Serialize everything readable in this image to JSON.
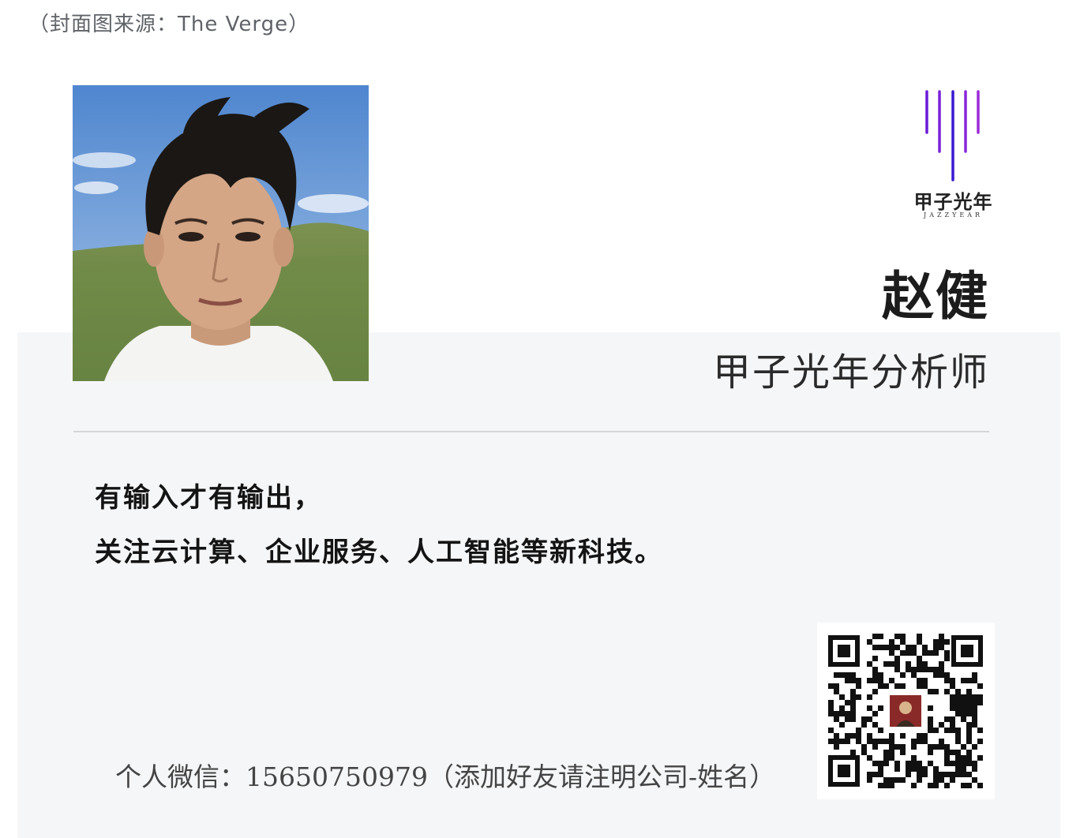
{
  "caption": "（封面图来源：The Verge）",
  "logo": {
    "name": "甲子光年",
    "sub": "JAZZYEAR",
    "accent_colors": [
      "#6a1bd6",
      "#9b2bd9",
      "#3a1ad0"
    ]
  },
  "profile": {
    "name": "赵健",
    "title": "甲子光年分析师",
    "photo_icon": "portrait-photo"
  },
  "motto": {
    "line1": "有输入才有输出，",
    "line2": "关注云计算、企业服务、人工智能等新科技。"
  },
  "contact": {
    "wechat": "个人微信：15650750979（添加好友请注明公司-姓名）",
    "qr_icon": "wechat-qr-code-icon"
  },
  "colors": {
    "card_background": "#f5f6f8",
    "divider": "#d3d6da",
    "text_primary": "#1c1c1c"
  }
}
